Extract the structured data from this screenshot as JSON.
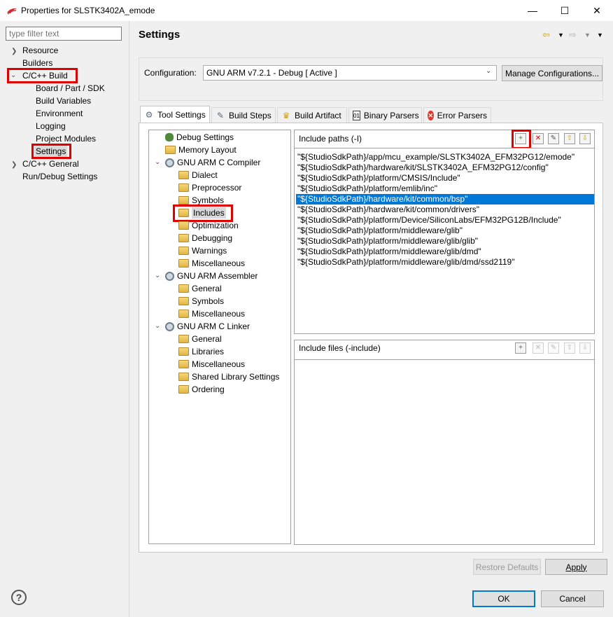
{
  "window": {
    "title": "Properties for SLSTK3402A_emode",
    "minimize_glyph": "—",
    "maximize_glyph": "☐",
    "close_glyph": "✕"
  },
  "left_nav": {
    "filter_placeholder": "type filter text",
    "items": [
      {
        "label": "Resource"
      },
      {
        "label": "Builders"
      },
      {
        "label": "C/C++ Build"
      },
      {
        "label": "Board / Part / SDK"
      },
      {
        "label": "Build Variables"
      },
      {
        "label": "Environment"
      },
      {
        "label": "Logging"
      },
      {
        "label": "Project Modules"
      },
      {
        "label": "Settings"
      },
      {
        "label": "C/C++ General"
      },
      {
        "label": "Run/Debug Settings"
      }
    ]
  },
  "header": {
    "title": "Settings"
  },
  "configuration": {
    "label": "Configuration:",
    "selected": "GNU ARM v7.2.1 - Debug  [ Active ]",
    "manage_button": "Manage Configurations..."
  },
  "tabs": [
    {
      "label": "Tool Settings",
      "icon": "tool-settings-icon"
    },
    {
      "label": "Build Steps",
      "icon": "build-steps-icon"
    },
    {
      "label": "Build Artifact",
      "icon": "trophy-icon"
    },
    {
      "label": "Binary Parsers",
      "icon": "binary-icon"
    },
    {
      "label": "Error Parsers",
      "icon": "error-icon"
    }
  ],
  "tool_tree": {
    "items": [
      {
        "label": "Debug Settings"
      },
      {
        "label": "Memory Layout"
      },
      {
        "label": "GNU ARM C Compiler"
      },
      {
        "label": "Dialect"
      },
      {
        "label": "Preprocessor"
      },
      {
        "label": "Symbols"
      },
      {
        "label": "Includes"
      },
      {
        "label": "Optimization"
      },
      {
        "label": "Debugging"
      },
      {
        "label": "Warnings"
      },
      {
        "label": "Miscellaneous"
      },
      {
        "label": "GNU ARM Assembler"
      },
      {
        "label": "General"
      },
      {
        "label": "Symbols"
      },
      {
        "label": "Miscellaneous"
      },
      {
        "label": "GNU ARM C Linker"
      },
      {
        "label": "General"
      },
      {
        "label": "Libraries"
      },
      {
        "label": "Miscellaneous"
      },
      {
        "label": "Shared Library Settings"
      },
      {
        "label": "Ordering"
      }
    ]
  },
  "include_paths": {
    "label": "Include paths (-I)",
    "selected_index": 4,
    "items": [
      "\"${StudioSdkPath}/app/mcu_example/SLSTK3402A_EFM32PG12/emode\"",
      "\"${StudioSdkPath}/hardware/kit/SLSTK3402A_EFM32PG12/config\"",
      "\"${StudioSdkPath}/platform/CMSIS/Include\"",
      "\"${StudioSdkPath}/platform/emlib/inc\"",
      "\"${StudioSdkPath}/hardware/kit/common/bsp\"",
      "\"${StudioSdkPath}/hardware/kit/common/drivers\"",
      "\"${StudioSdkPath}/platform/Device/SiliconLabs/EFM32PG12B/Include\"",
      "\"${StudioSdkPath}/platform/middleware/glib\"",
      "\"${StudioSdkPath}/platform/middleware/glib/glib\"",
      "\"${StudioSdkPath}/platform/middleware/glib/dmd\"",
      "\"${StudioSdkPath}/platform/middleware/glib/dmd/ssd2119\""
    ]
  },
  "include_files": {
    "label": "Include files (-include)"
  },
  "buttons": {
    "restore_defaults": "Restore Defaults",
    "apply": "Apply",
    "ok": "OK",
    "cancel": "Cancel"
  },
  "colors": {
    "highlight": "#e00000",
    "selection": "#0078d7"
  }
}
